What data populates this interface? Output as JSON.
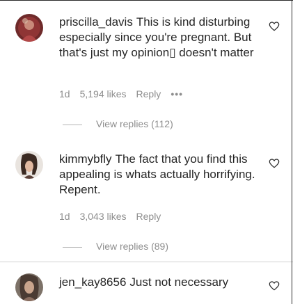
{
  "comments": [
    {
      "username": "priscilla_davis",
      "text": "This is kind disturbing especially since you're pregnant. But that's just my opinion▯ doesn't matter",
      "time": "1d",
      "likes": "5,194 likes",
      "reply": "Reply",
      "more": "•••",
      "view_replies": "View replies (112)"
    },
    {
      "username": "kimmybfly",
      "text": "The fact that you find this appealing is whats actually horrifying. Repent.",
      "time": "1d",
      "likes": "3,043 likes",
      "reply": "Reply",
      "view_replies": "View replies (89)"
    },
    {
      "username": "jen_kay8656",
      "text": "Just not necessary"
    }
  ],
  "icons": {
    "like": "heart-outline-icon"
  },
  "colors": {
    "text": "#262626",
    "secondary": "#8e8e8e"
  }
}
